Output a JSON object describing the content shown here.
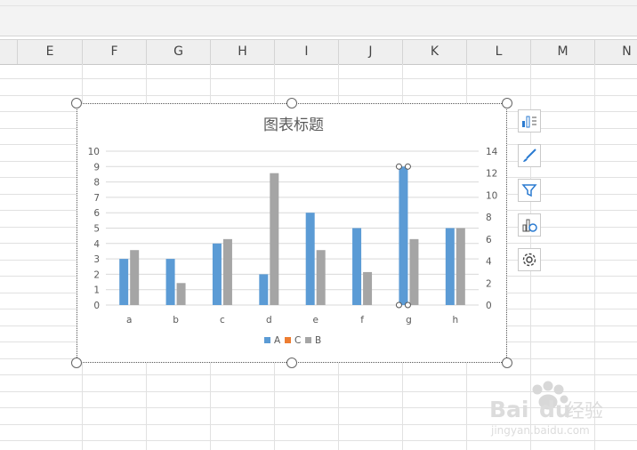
{
  "columns": [
    "E",
    "F",
    "G",
    "H",
    "I",
    "J",
    "K",
    "L",
    "M",
    "N"
  ],
  "side_buttons": [
    {
      "name": "chart-elements-icon"
    },
    {
      "name": "chart-styles-brush-icon"
    },
    {
      "name": "chart-filter-icon"
    },
    {
      "name": "chart-data-settings-icon"
    },
    {
      "name": "chart-settings-gear-icon"
    }
  ],
  "watermark": {
    "logo": "Bai du 经验",
    "url": "jingyan.baidu.com"
  },
  "chart_data": {
    "type": "bar",
    "title": "图表标题",
    "categories": [
      "a",
      "b",
      "c",
      "d",
      "e",
      "f",
      "g",
      "h"
    ],
    "series": [
      {
        "name": "A",
        "axis": "primary",
        "color": "#5B9BD5",
        "values": [
          3,
          3,
          4,
          2,
          6,
          5,
          9,
          5
        ]
      },
      {
        "name": "C",
        "axis": "primary",
        "color": "#ED7D31",
        "values": [
          null,
          null,
          null,
          null,
          null,
          null,
          null,
          null
        ]
      },
      {
        "name": "B",
        "axis": "secondary",
        "color": "#A5A5A5",
        "values": [
          5,
          2,
          6,
          12,
          5,
          3,
          6,
          7
        ]
      }
    ],
    "ylim": [
      0,
      10
    ],
    "y_ticks": [
      "0",
      "1",
      "2",
      "3",
      "4",
      "5",
      "6",
      "7",
      "8",
      "9",
      "10"
    ],
    "y2lim": [
      0,
      14
    ],
    "y2_ticks": [
      "0",
      "2",
      "4",
      "6",
      "8",
      "10",
      "12",
      "14"
    ],
    "selected_point": {
      "series": "A",
      "category": "g"
    },
    "legend_position": "bottom",
    "grid": true
  }
}
